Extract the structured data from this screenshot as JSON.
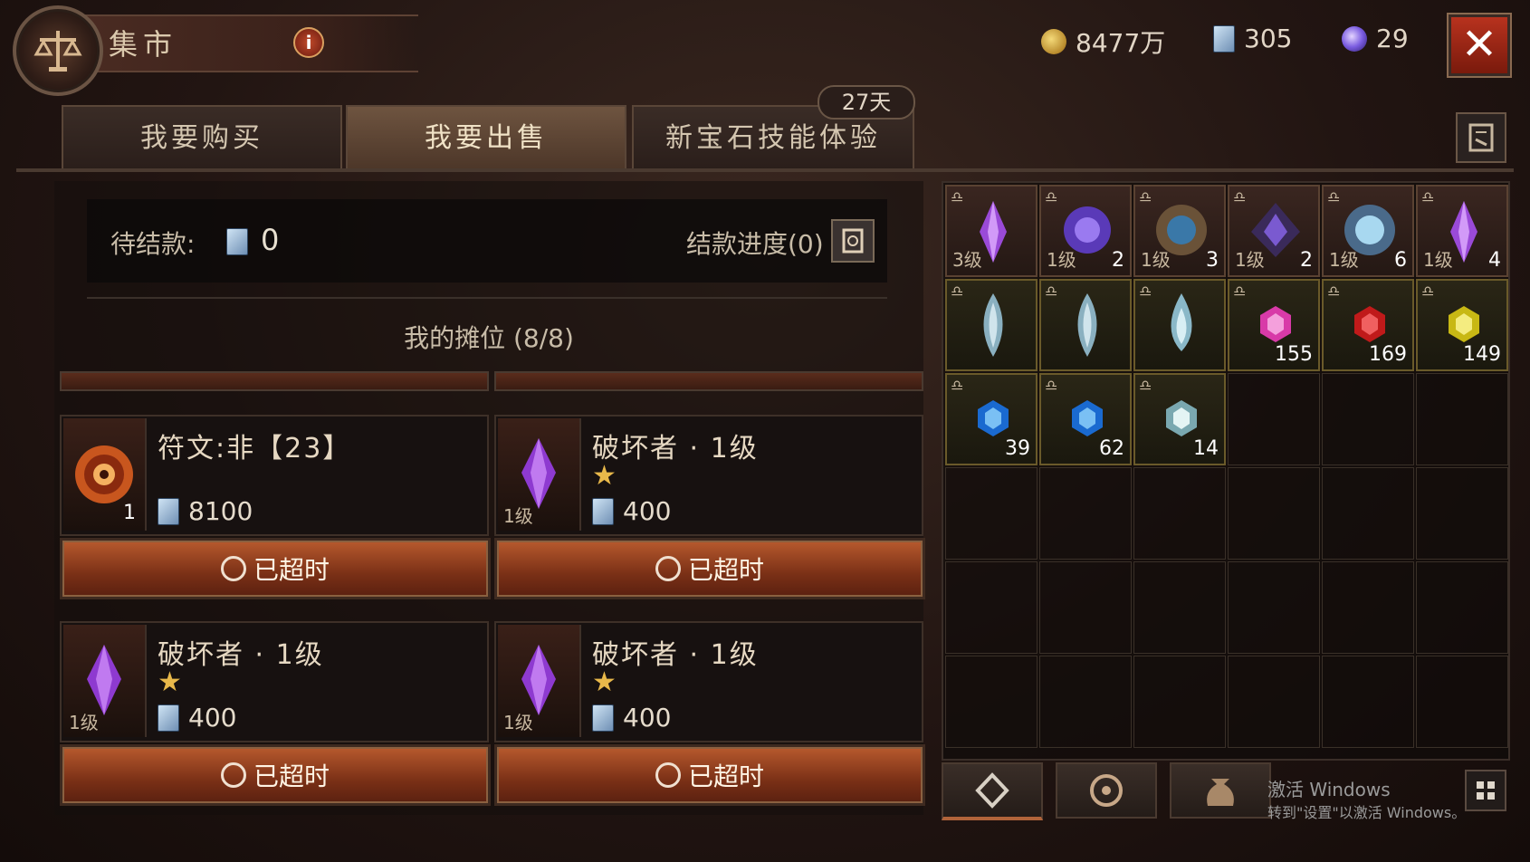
{
  "header": {
    "title": "集市",
    "info_icon": "i",
    "currencies": [
      {
        "icon": "gold-coin-icon",
        "value": "8477万"
      },
      {
        "icon": "card-currency-icon",
        "value": "305"
      },
      {
        "icon": "purple-orb-icon",
        "value": "29"
      }
    ],
    "close_icon": "✕"
  },
  "tabs": [
    {
      "label": "我要购买",
      "active": false
    },
    {
      "label": "我要出售",
      "active": true
    },
    {
      "label": "新宝石技能体验",
      "active": false
    }
  ],
  "tab_badge": "27天",
  "settlement": {
    "label": "待结款:",
    "value": "0",
    "progress_label": "结款进度(0)"
  },
  "stall": {
    "title": "我的摊位 (8/8)",
    "items": [
      {
        "name": "符文:非【23】",
        "star": "",
        "price": "8100",
        "level": "",
        "qty": "1",
        "status": "已超时"
      },
      {
        "name": "破坏者 · 1级",
        "star": "★",
        "price": "400",
        "level": "1级",
        "qty": "",
        "status": "已超时"
      },
      {
        "name": "破坏者 · 1级",
        "star": "★",
        "price": "400",
        "level": "1级",
        "qty": "",
        "status": "已超时"
      },
      {
        "name": "破坏者 · 1级",
        "star": "★",
        "price": "400",
        "level": "1级",
        "qty": "",
        "status": "已超时"
      }
    ]
  },
  "inventory": [
    {
      "level": "3级",
      "count": "",
      "kind": "purple-crystal"
    },
    {
      "level": "1级",
      "count": "2",
      "kind": "purple-orb-gem"
    },
    {
      "level": "1级",
      "count": "3",
      "kind": "bronze-gem"
    },
    {
      "level": "1级",
      "count": "2",
      "kind": "dark-purple-gem"
    },
    {
      "level": "1级",
      "count": "6",
      "kind": "ice-gem"
    },
    {
      "level": "1级",
      "count": "4",
      "kind": "purple-crystal"
    },
    {
      "level": "",
      "count": "",
      "kind": "silver-leaf"
    },
    {
      "level": "",
      "count": "",
      "kind": "silver-leaf"
    },
    {
      "level": "",
      "count": "",
      "kind": "silver-drop"
    },
    {
      "level": "",
      "count": "155",
      "kind": "pink-gem"
    },
    {
      "level": "",
      "count": "169",
      "kind": "red-gem"
    },
    {
      "level": "",
      "count": "149",
      "kind": "yellow-gem"
    },
    {
      "level": "",
      "count": "39",
      "kind": "blue-gem"
    },
    {
      "level": "",
      "count": "62",
      "kind": "blue-gem"
    },
    {
      "level": "",
      "count": "14",
      "kind": "white-gem"
    }
  ],
  "inventory_lock_glyph": "♎",
  "watermark": {
    "line1": "激活 Windows",
    "line2": "转到\"设置\"以激活 Windows。"
  },
  "colors": {
    "accent_orange": "#b85a2e",
    "gold_text": "#e8b84a",
    "close_red": "#b8321e"
  }
}
